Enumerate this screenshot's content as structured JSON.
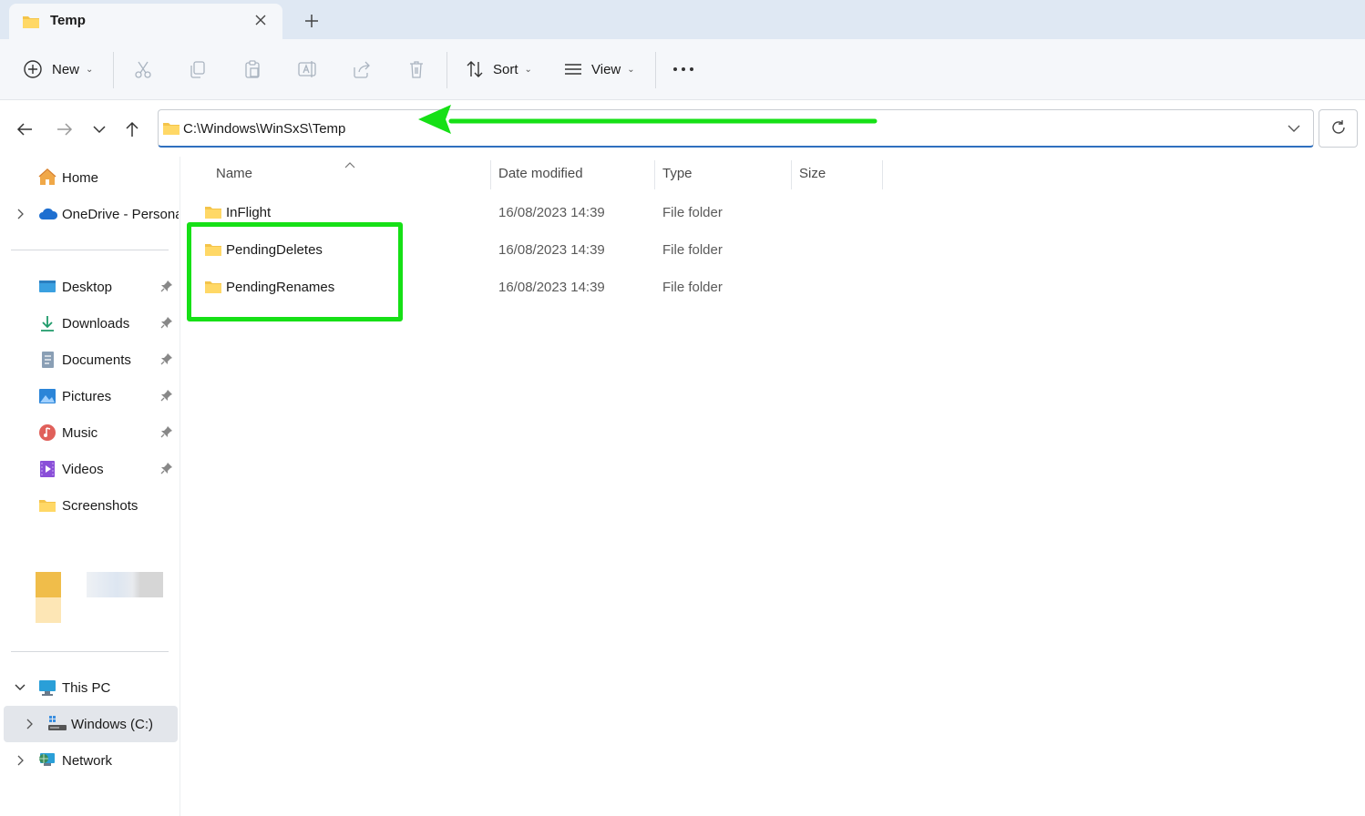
{
  "window": {
    "tab_title": "Temp",
    "tab_close_icon": "close-icon",
    "new_tab_icon": "plus-icon"
  },
  "toolbar": {
    "new_label": "New",
    "sort_label": "Sort",
    "view_label": "View",
    "icons": [
      "plus-circle-icon",
      "cut-icon",
      "copy-icon",
      "paste-icon",
      "rename-icon",
      "share-icon",
      "delete-icon",
      "sort-icon",
      "view-icon",
      "more-icon"
    ]
  },
  "address": {
    "path": "C:\\Windows\\WinSxS\\Temp"
  },
  "sidebar": {
    "home": "Home",
    "onedrive": "OneDrive - Persona",
    "quick_access": [
      {
        "label": "Desktop",
        "icon": "desktop-icon",
        "pinned": true
      },
      {
        "label": "Downloads",
        "icon": "download-icon",
        "pinned": true
      },
      {
        "label": "Documents",
        "icon": "document-icon",
        "pinned": true
      },
      {
        "label": "Pictures",
        "icon": "pictures-icon",
        "pinned": true
      },
      {
        "label": "Music",
        "icon": "music-icon",
        "pinned": true
      },
      {
        "label": "Videos",
        "icon": "videos-icon",
        "pinned": true
      },
      {
        "label": "Screenshots",
        "icon": "folder-icon",
        "pinned": false
      }
    ],
    "this_pc": "This PC",
    "windows_c": "Windows (C:)",
    "network": "Network"
  },
  "columns": {
    "name": "Name",
    "date_modified": "Date modified",
    "type": "Type",
    "size": "Size"
  },
  "files": [
    {
      "name": "InFlight",
      "date": "16/08/2023 14:39",
      "type": "File folder"
    },
    {
      "name": "PendingDeletes",
      "date": "16/08/2023 14:39",
      "type": "File folder"
    },
    {
      "name": "PendingRenames",
      "date": "16/08/2023 14:39",
      "type": "File folder"
    }
  ],
  "colors": {
    "accent": "#2f6fbf",
    "annotation_green": "#16e016",
    "folder_yellow": "#f4c44a"
  }
}
